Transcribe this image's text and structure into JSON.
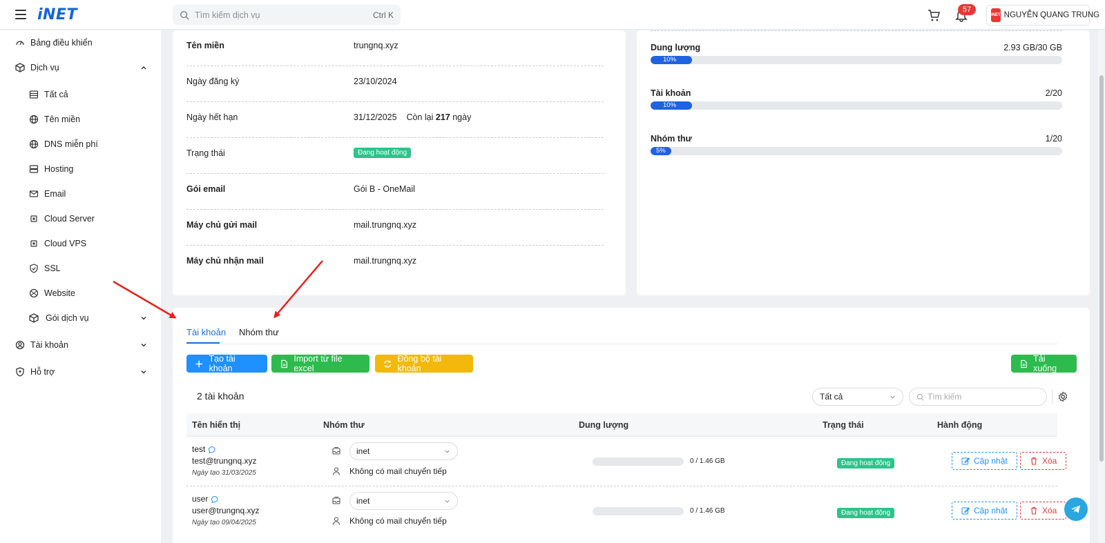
{
  "topbar": {
    "logo": "iNET",
    "search_placeholder": "Tìm kiếm dịch vụ",
    "search_shortcut": "Ctrl K",
    "notification_count": "57",
    "user_avatar_text": "iNET",
    "user_name": "NGUYỄN QUANG TRUNG"
  },
  "sidebar": {
    "items": [
      {
        "label": "Bảng điều khiển"
      },
      {
        "label": "Dịch vụ"
      },
      {
        "label": "Tất cả"
      },
      {
        "label": "Tên miền"
      },
      {
        "label": "DNS miễn phí"
      },
      {
        "label": "Hosting"
      },
      {
        "label": "Email"
      },
      {
        "label": "Cloud Server"
      },
      {
        "label": "Cloud VPS"
      },
      {
        "label": "SSL"
      },
      {
        "label": "Website"
      },
      {
        "label": "Gói dịch vụ"
      },
      {
        "label": "Tài khoản"
      },
      {
        "label": "Hỗ trợ"
      }
    ]
  },
  "info": {
    "domain_label": "Tên miền",
    "domain_value": "trungnq.xyz",
    "reg_label": "Ngày đăng ký",
    "reg_value": "23/10/2024",
    "exp_label": "Ngày hết hạn",
    "exp_value": "31/12/2025",
    "remaining_prefix": "Còn lại",
    "remaining_days": "217",
    "remaining_suffix": "ngày",
    "status_label": "Trạng thái",
    "status_value": "Đang hoạt động",
    "plan_label": "Gói email",
    "plan_value": "Gói B - OneMail",
    "smtp_label": "Máy chủ gửi mail",
    "smtp_value": "mail.trungnq.xyz",
    "imap_label": "Máy chủ nhận mail",
    "imap_value": "mail.trungnq.xyz"
  },
  "usage": {
    "storage": {
      "label": "Dung lượng",
      "value": "2.93 GB/30 GB",
      "percent": "10%",
      "fraction": 0.1
    },
    "accounts": {
      "label": "Tài khoản",
      "value": "2/20",
      "percent": "10%",
      "fraction": 0.1
    },
    "groups": {
      "label": "Nhóm thư",
      "value": "1/20",
      "percent": "5%",
      "fraction": 0.05
    }
  },
  "tabs": {
    "accounts": "Tài khoản",
    "groups": "Nhóm thư"
  },
  "actions": {
    "create": "Tạo tài khoản",
    "import": "Import từ file excel",
    "sync": "Đồng bộ tài khoản",
    "download": "Tải xuống"
  },
  "list": {
    "count": "2 tài khoản",
    "filter_selected": "Tất cả",
    "search_placeholder": "Tìm kiếm"
  },
  "table": {
    "headers": [
      "Tên hiển thị",
      "Nhóm thư",
      "Dung lượng",
      "Trạng thái",
      "Hành động"
    ],
    "rows": [
      {
        "name": "test",
        "email": "test@trungnq.xyz",
        "created": "Ngày tạo 31/03/2025",
        "group": "inet",
        "forward": "Không có mail chuyển tiếp",
        "usage": "0 / 1.46 GB",
        "status": "Đang hoạt động",
        "update": "Cập nhật",
        "delete": "Xóa"
      },
      {
        "name": "user",
        "email": "user@trungnq.xyz",
        "created": "Ngày tạo 09/04/2025",
        "group": "inet",
        "forward": "Không có mail chuyển tiếp",
        "usage": "0 / 1.46 GB",
        "status": "Đang hoạt động",
        "update": "Cập nhật",
        "delete": "Xóa"
      }
    ]
  },
  "colors": {
    "brand": "#1565d8",
    "accent_blue": "#1e90ff",
    "success": "#2dbb4e",
    "warning": "#f2b90c",
    "danger": "#e53935",
    "status_active": "#2bc48a",
    "arrow": "#e8201a"
  }
}
